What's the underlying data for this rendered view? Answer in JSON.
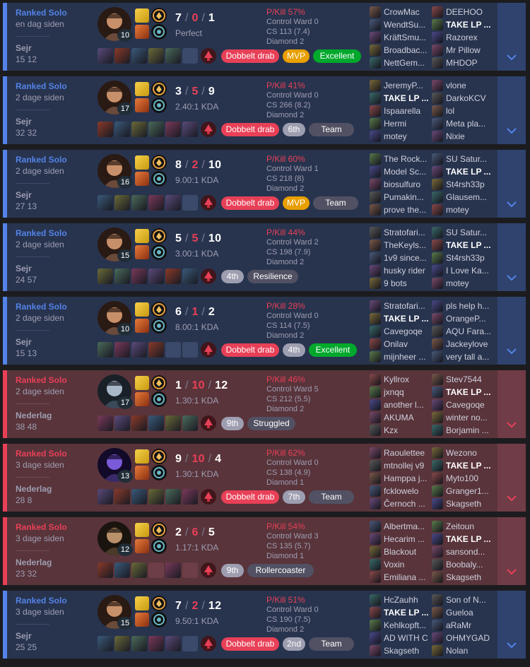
{
  "colors": {
    "win_bg": "#28344e",
    "loss_bg": "#59343b",
    "win_accent": "#5383e8",
    "loss_accent": "#e84057"
  },
  "matches": [
    {
      "result": "win",
      "queue": "Ranked Solo",
      "ago": "en dag siden",
      "outcome": "Sejr",
      "duration": "15 12",
      "champion_icon": "graves-portrait",
      "level": "10",
      "k": "7",
      "d": "0",
      "a": "1",
      "ratio": "Perfect",
      "pkill": "P/Kill 57%",
      "ward": "Control Ward 0",
      "cs": "CS 113 (7.4)",
      "rank": "Diamond 2",
      "items": [
        "i",
        "i",
        "i",
        "i",
        "i",
        "empty"
      ],
      "badges": [
        [
          "Dobbelt drab",
          "red"
        ],
        [
          "MVP",
          "gold"
        ],
        [
          "Excellent",
          "green"
        ]
      ],
      "team1": [
        "CrowMac",
        "WendtSu...",
        "KräftSmu...",
        "Broadbac...",
        "NettGem..."
      ],
      "team2": [
        "DEEHOO",
        "TAKE LP ...",
        "Razorex",
        "Mr Pillow",
        "MHDOP"
      ],
      "me": "2-1"
    },
    {
      "result": "win",
      "queue": "Ranked Solo",
      "ago": "2 dage siden",
      "outcome": "Sejr",
      "duration": "32 32",
      "champion_icon": "graves-portrait",
      "level": "17",
      "k": "3",
      "d": "5",
      "a": "9",
      "ratio": "2.40:1 KDA",
      "pkill": "P/Kill 41%",
      "ward": "Control Ward 0",
      "cs": "CS 266 (8.2)",
      "rank": "Diamond 2",
      "items": [
        "i",
        "i",
        "i",
        "i",
        "i",
        "i"
      ],
      "badges": [
        [
          "Dobbelt drab",
          "red"
        ],
        [
          "6th",
          "gray"
        ],
        [
          "Team",
          "dark"
        ]
      ],
      "team1": [
        "JeremyP...",
        "TAKE LP ...",
        "Ispaarella",
        "Hermi",
        "motey"
      ],
      "team2": [
        "vlone",
        "DarkoKCV",
        "lol",
        "Meta pla...",
        "Nixie"
      ],
      "me": "1-1"
    },
    {
      "result": "win",
      "queue": "Ranked Solo",
      "ago": "2 dage siden",
      "outcome": "Sejr",
      "duration": "27 13",
      "champion_icon": "graves-portrait",
      "level": "16",
      "k": "8",
      "d": "2",
      "a": "10",
      "ratio": "9.00:1 KDA",
      "pkill": "P/Kill 60%",
      "ward": "Control Ward 1",
      "cs": "CS 218 (8)",
      "rank": "Diamond 2",
      "items": [
        "i",
        "i",
        "i",
        "i",
        "i",
        "empty"
      ],
      "badges": [
        [
          "Dobbelt drab",
          "red"
        ],
        [
          "MVP",
          "gold"
        ],
        [
          "Team",
          "dark"
        ]
      ],
      "team1": [
        "The Rock...",
        "Model Sc...",
        "biosulfuro",
        "Pumakin...",
        "prove the..."
      ],
      "team2": [
        "SU Satur...",
        "TAKE LP ...",
        "St4rsh33p",
        "Glausem...",
        "motey"
      ],
      "me": "2-1"
    },
    {
      "result": "win",
      "queue": "Ranked Solo",
      "ago": "2 dage siden",
      "outcome": "Sejr",
      "duration": "24 57",
      "champion_icon": "graves-portrait",
      "level": "15",
      "k": "5",
      "d": "5",
      "a": "10",
      "ratio": "3.00:1 KDA",
      "pkill": "P/Kill 44%",
      "ward": "Control Ward 2",
      "cs": "CS 198 (7.9)",
      "rank": "Diamond 2",
      "items": [
        "i",
        "i",
        "i",
        "i",
        "i",
        "i"
      ],
      "badges": [
        [
          "4th",
          "gray"
        ],
        [
          "Resilience",
          "dark"
        ]
      ],
      "team1": [
        "Stratofari...",
        "TheKeyls...",
        "1v9 since...",
        "husky rider",
        "9 bots"
      ],
      "team2": [
        "SU Satur...",
        "TAKE LP ...",
        "St4rsh33p",
        "I Love Ka...",
        "motey"
      ],
      "me": "2-1"
    },
    {
      "result": "win",
      "queue": "Ranked Solo",
      "ago": "2 dage siden",
      "outcome": "Sejr",
      "duration": "15 13",
      "champion_icon": "graves-portrait",
      "level": "10",
      "k": "6",
      "d": "1",
      "a": "2",
      "ratio": "8.00:1 KDA",
      "pkill": "P/Kill 28%",
      "ward": "Control Ward 0",
      "cs": "CS 114 (7.5)",
      "rank": "Diamond 2",
      "items": [
        "i",
        "i",
        "i",
        "i",
        "empty",
        "empty"
      ],
      "badges": [
        [
          "Dobbelt drab",
          "red"
        ],
        [
          "4th",
          "gray"
        ],
        [
          "Excellent",
          "green"
        ]
      ],
      "team1": [
        "Stratofari...",
        "TAKE LP ...",
        "Cavegoqe",
        "Onilav",
        "mijnheer ..."
      ],
      "team2": [
        "pls help h...",
        "OrangeP...",
        "AQU Fara...",
        "Jackeylove",
        "very tall a..."
      ],
      "me": "1-1"
    },
    {
      "result": "loss",
      "queue": "Ranked Solo",
      "ago": "2 dage siden",
      "outcome": "Nederlag",
      "duration": "38 48",
      "champion_icon": "olaf-portrait",
      "level": "17",
      "k": "1",
      "d": "10",
      "a": "12",
      "ratio": "1.30:1 KDA",
      "pkill": "P/Kill 46%",
      "ward": "Control Ward 5",
      "cs": "CS 212 (5.5)",
      "rank": "Diamond 2",
      "items": [
        "i",
        "i",
        "i",
        "i",
        "i",
        "i"
      ],
      "badges": [
        [
          "9th",
          "gray"
        ],
        [
          "Struggled",
          "dark"
        ]
      ],
      "team1": [
        "Kyllrox",
        "jxnqq",
        "another l...",
        "AKUMA",
        "Kzx"
      ],
      "team2": [
        "Stev7544",
        "TAKE LP ...",
        "Cavegoqe",
        "winter no...",
        "Borjamin ..."
      ],
      "me": "2-1"
    },
    {
      "result": "loss",
      "queue": "Ranked Solo",
      "ago": "3 dage siden",
      "outcome": "Nederlag",
      "duration": "28 8",
      "champion_icon": "kassadin-portrait",
      "level": "13",
      "k": "9",
      "d": "10",
      "a": "4",
      "ratio": "1.30:1 KDA",
      "pkill": "P/Kill 62%",
      "ward": "Control Ward 0",
      "cs": "CS 138 (4.9)",
      "rank": "Diamond 1",
      "items": [
        "i",
        "i",
        "i",
        "i",
        "i",
        "i"
      ],
      "badges": [
        [
          "Dobbelt drab",
          "red"
        ],
        [
          "7th",
          "gray"
        ],
        [
          "Team",
          "dark"
        ]
      ],
      "team1": [
        "Raoulettee",
        "mtnollej v9",
        "Hamppa j...",
        "fcklowelo",
        "Černoch ..."
      ],
      "team2": [
        "Wezono",
        "TAKE LP ...",
        "Myto100",
        "Granger1...",
        "Skagseth"
      ],
      "me": "2-1"
    },
    {
      "result": "loss",
      "queue": "Ranked Solo",
      "ago": "3 dage siden",
      "outcome": "Nederlag",
      "duration": "23 32",
      "champion_icon": "talon-portrait",
      "level": "12",
      "k": "2",
      "d": "6",
      "a": "5",
      "ratio": "1.17:1 KDA",
      "pkill": "P/Kill 54%",
      "ward": "Control Ward 3",
      "cs": "CS 135 (5.7)",
      "rank": "Diamond 1",
      "items": [
        "i",
        "i",
        "i",
        "empty",
        "i",
        "empty"
      ],
      "badges": [
        [
          "9th",
          "gray"
        ],
        [
          "Rollercoaster",
          "dark"
        ]
      ],
      "team1": [
        "Albertma...",
        "Hecarim ...",
        "Blackout",
        "Voxin",
        "Emiliana ..."
      ],
      "team2": [
        "Zeitoun",
        "TAKE LP ...",
        "sansond...",
        "Boobaly...",
        "Skagseth"
      ],
      "me": "2-1"
    },
    {
      "result": "win",
      "queue": "Ranked Solo",
      "ago": "3 dage siden",
      "outcome": "Sejr",
      "duration": "25 25",
      "champion_icon": "graves-portrait",
      "level": "15",
      "k": "7",
      "d": "2",
      "a": "12",
      "ratio": "9.50:1 KDA",
      "pkill": "P/Kill 51%",
      "ward": "Control Ward 0",
      "cs": "CS 190 (7.5)",
      "rank": "Diamond 2",
      "items": [
        "i",
        "i",
        "i",
        "i",
        "i",
        "empty"
      ],
      "badges": [
        [
          "Dobbelt drab",
          "red"
        ],
        [
          "2nd",
          "gray"
        ],
        [
          "Team",
          "dark"
        ]
      ],
      "team1": [
        "HcZauhh",
        "TAKE LP ...",
        "Kehlkopft...",
        "AD WITH C",
        "Skagseth"
      ],
      "team2": [
        "Son of N...",
        "Gueloa",
        "aRaMr",
        "OHMYGAD",
        "Nolan"
      ],
      "me": "1-1"
    }
  ],
  "icons": {
    "expand": "chevron-down-icon",
    "ward": "control-ward-icon",
    "spell1": "flash-spell-icon",
    "spell2": "smite-spell-icon",
    "rune1": "keystone-rune-icon",
    "rune2": "secondary-rune-icon"
  }
}
